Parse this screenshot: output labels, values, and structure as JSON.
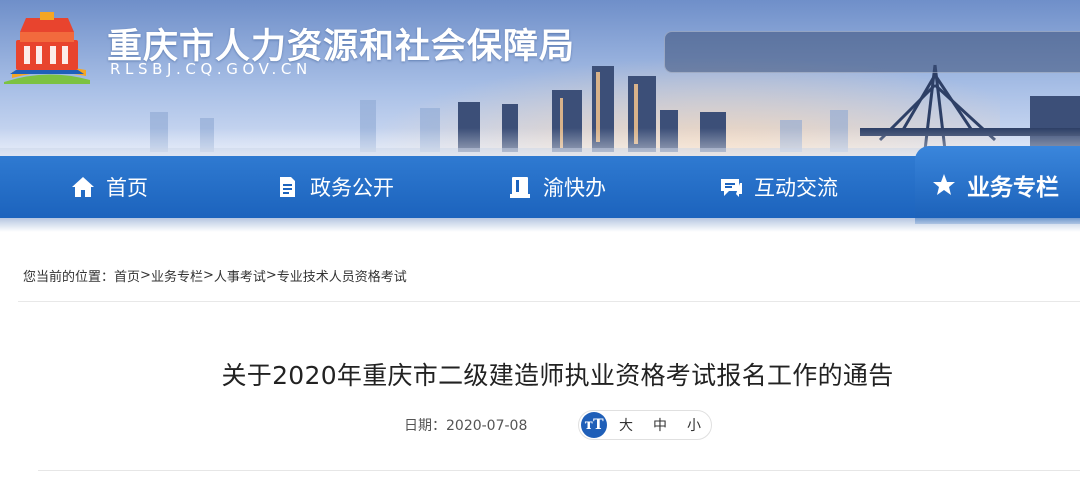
{
  "header": {
    "site_title": "重庆市人力资源和社会保障局",
    "site_domain": "RLSBJ.CQ.GOV.CN"
  },
  "nav": {
    "items": [
      {
        "label": "首页",
        "icon": "home-icon"
      },
      {
        "label": "政务公开",
        "icon": "document-icon"
      },
      {
        "label": "渝快办",
        "icon": "book-icon"
      },
      {
        "label": "互动交流",
        "icon": "chat-icon"
      },
      {
        "label": "业务专栏",
        "icon": "star-icon",
        "active": true
      }
    ]
  },
  "breadcrumb": {
    "prefix": "您当前的位置：",
    "items": [
      "首页",
      "业务专栏",
      "人事考试",
      "专业技术人员资格考试"
    ],
    "separator": ">"
  },
  "article": {
    "title": "关于2020年重庆市二级建造师执业资格考试报名工作的通告",
    "date": "日期：2020-07-08",
    "font_size_icon_text": "тT",
    "font_size_options": [
      "大",
      "中",
      "小"
    ]
  },
  "colors": {
    "nav_blue": "#1c63bd",
    "font_badge_blue": "#1f5fb8"
  }
}
